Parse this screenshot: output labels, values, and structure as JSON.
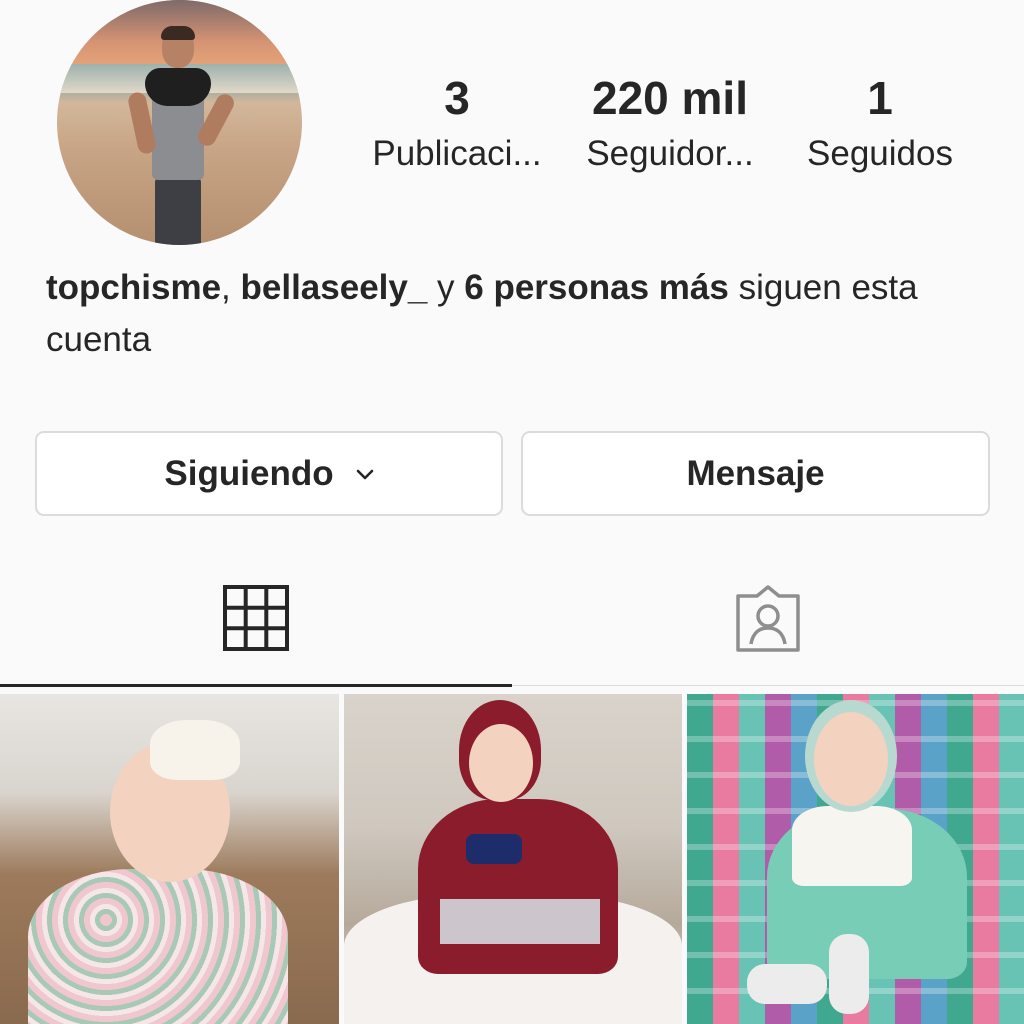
{
  "profile": {
    "avatar_alt": "profile-photo"
  },
  "stats": {
    "posts_count": "3",
    "posts_label": "Publicaci...",
    "followers_count": "220 mil",
    "followers_label": "Seguidor...",
    "following_count": "1",
    "following_label": "Seguidos"
  },
  "followed_by": {
    "user1": "topchisme",
    "sep": ", ",
    "user2": "bellaseely_",
    "and": " y ",
    "others": "6 personas más",
    "suffix": " siguen esta cuenta"
  },
  "actions": {
    "following_label": "Siguiendo",
    "message_label": "Mensaje"
  },
  "tabs": {
    "grid_icon": "grid-icon",
    "tagged_icon": "tagged-person-icon"
  },
  "posts": [
    {
      "id": "post-1",
      "description_hidden": true
    },
    {
      "id": "post-2",
      "description_hidden": true
    },
    {
      "id": "post-3",
      "description_hidden": true
    }
  ],
  "colors": {
    "text": "#262626",
    "border": "#dbdbdb",
    "background": "#fafafa"
  }
}
